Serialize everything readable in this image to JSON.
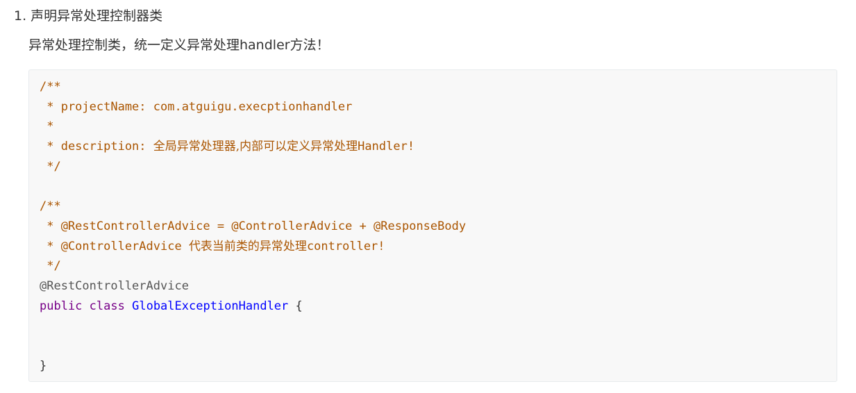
{
  "heading": {
    "number": "1.",
    "text": "声明异常处理控制器类"
  },
  "description": "异常处理控制类，统一定义异常处理handler方法！",
  "code": {
    "l1": "/**",
    "l2": " * projectName: com.atguigu.execptionhandler",
    "l3": " *",
    "l4_prefix": " * description: ",
    "l4_cjk": "全局异常处理器,内部可以定义异常处理",
    "l4_suffix": "Handler!",
    "l5": " */",
    "l7": "/**",
    "l8": " * @RestControllerAdvice = @ControllerAdvice + @ResponseBody",
    "l9_prefix": " * @ControllerAdvice ",
    "l9_cjk": "代表当前类的异常处理",
    "l9_suffix": "controller!",
    "l10": " */",
    "l11": "@RestControllerAdvice",
    "l12_kw1": "public",
    "l12_kw2": "class",
    "l12_name": "GlobalExceptionHandler",
    "l12_brace": "{",
    "l15": "}"
  },
  "colors": {
    "comment": "#aa5500",
    "keyword": "#770088",
    "class_name": "#0000ff",
    "text": "#333333",
    "code_background": "#f8f8f8"
  }
}
